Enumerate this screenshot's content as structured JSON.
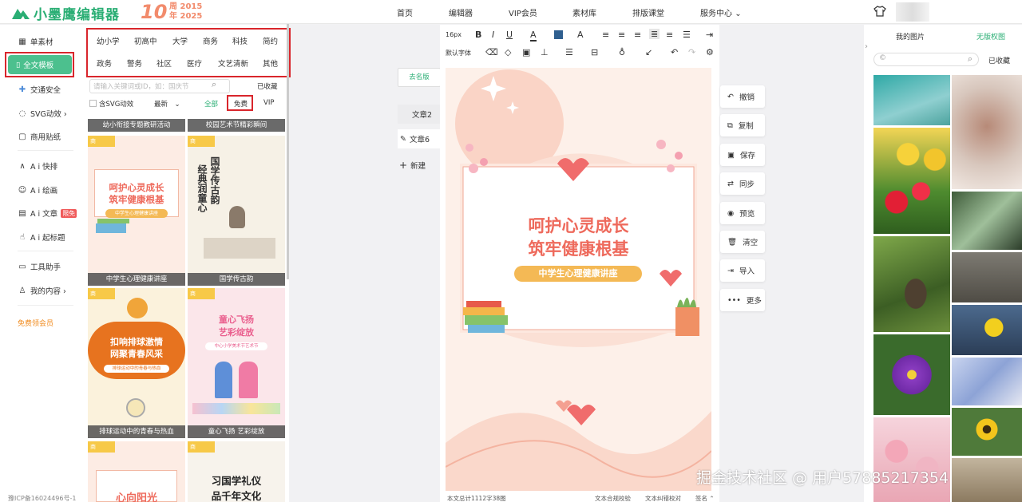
{
  "header": {
    "logo_text": "小墨鹰编辑器",
    "anniv_number": "10",
    "anniv_line1": "周 2015",
    "anniv_line2": "年 2025",
    "nav": [
      "首页",
      "编辑器",
      "VIP会员",
      "素材库",
      "排版课堂",
      "服务中心"
    ],
    "service_arrow": "⌄"
  },
  "left_nav": {
    "items": [
      {
        "label": "单素材"
      },
      {
        "label": "全文模板"
      },
      {
        "label": "交通安全"
      },
      {
        "label": "SVG动效 ›"
      },
      {
        "label": "商用贴纸"
      },
      {
        "label": "A i 快排"
      },
      {
        "label": "A i 绘画"
      },
      {
        "label": "A i 文章",
        "badge": "限免"
      },
      {
        "label": "A i 起标题"
      },
      {
        "label": "工具助手"
      },
      {
        "label": "我的内容 ›"
      }
    ],
    "vip_link": "免费领会员",
    "icp": "豫ICP备16024496号-1"
  },
  "templates": {
    "categories_row1": [
      "幼小学",
      "初高中",
      "大学",
      "商务",
      "科技",
      "简约"
    ],
    "categories_row2": [
      "政务",
      "警务",
      "社区",
      "医疗",
      "文艺清新",
      "其他"
    ],
    "search_placeholder": "请输入关键词或ID，如：国庆节",
    "favorites": "已收藏",
    "filter_svg": "含SVG动效",
    "filter_sort": "最新",
    "filter_all": "全部",
    "filter_free": "免费",
    "filter_vip": "VIP",
    "top_captions": [
      "幼小衔接专题教研活动",
      "校园艺术节精彩瞬间"
    ],
    "ribbon": "商",
    "cards": [
      {
        "caption": "中学生心理健康讲座",
        "line1": "呵护心灵成长",
        "line2": "筑牢健康根基",
        "sub": "中学生心理健康讲座"
      },
      {
        "caption": "国学传古韵",
        "v1": "国学",
        "v2": "传古",
        "v3": "韵",
        "v4": "经典",
        "v5": "润",
        "v6": "童心"
      },
      {
        "caption": "排球运动中的青春与热血",
        "line1": "扣响排球激情",
        "line2": "网聚青春风采",
        "sub": "排球运动中的青春与热血"
      },
      {
        "caption": "童心飞扬 艺彩绽放",
        "line1": "童心飞扬",
        "line2": "艺彩绽放",
        "sub": "中心小学美术节艺术节"
      },
      {
        "line1": "心向阳光"
      },
      {
        "line1": "习国学礼仪",
        "line2": "品千年文化"
      }
    ]
  },
  "docs": {
    "remove": "去名版",
    "items": [
      "文章2",
      "文章6"
    ],
    "new": "新建"
  },
  "editor": {
    "font_size": "16px",
    "font_family": "默认字体",
    "canvas_line1": "呵护心灵成长",
    "canvas_line2": "筑牢健康根基",
    "canvas_sub": "中学生心理健康讲座",
    "status_count": "本文总计1112字38图",
    "status_check": "文本合规校验",
    "status_fix": "文本纠错校对",
    "status_sign": "签名 ⌃"
  },
  "actions": [
    "撤销",
    "复制",
    "保存",
    "同步",
    "预览",
    "清空",
    "导入",
    "更多"
  ],
  "right_panel": {
    "tabs": [
      "我的图片",
      "无版权图"
    ],
    "search_icon_text": "©",
    "favorites": "已收藏"
  },
  "watermark": "掘金技术社区 @ 用户57885217354",
  "colors": {
    "brand": "#2aae74",
    "accent": "#4cc08e",
    "highlight": "#d9262c",
    "pink": "#f06c6c"
  }
}
